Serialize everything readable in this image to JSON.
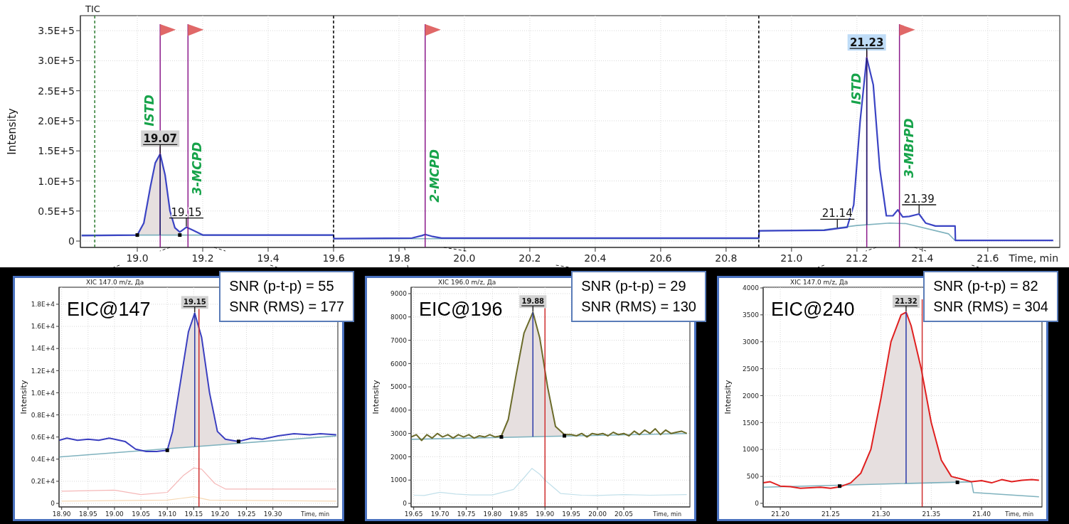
{
  "overview": {
    "title": "TIC",
    "chart_data": {
      "type": "line",
      "xlabel": "Time, min",
      "ylabel": "Intensity",
      "xlim": [
        18.826,
        21.82
      ],
      "ylim": [
        -10600,
        375000
      ],
      "grid": true,
      "xticks": [
        {
          "value": 19.0,
          "label": "19.0"
        },
        {
          "value": 19.2,
          "label": "19.2"
        },
        {
          "value": 19.4,
          "label": "19.4"
        },
        {
          "value": 19.6,
          "label": "19.6"
        },
        {
          "value": 19.8,
          "label": "19.8"
        },
        {
          "value": 20.0,
          "label": "20.0"
        },
        {
          "value": 20.2,
          "label": "20.2"
        },
        {
          "value": 20.4,
          "label": "20.4"
        },
        {
          "value": 20.6,
          "label": "20.6"
        },
        {
          "value": 20.8,
          "label": "20.8"
        },
        {
          "value": 21.0,
          "label": "21.0"
        },
        {
          "value": 21.2,
          "label": "21.2"
        },
        {
          "value": 21.4,
          "label": "21.4"
        },
        {
          "value": 21.6,
          "label": "21.6"
        }
      ],
      "yticks": [
        {
          "value": 0,
          "label": "0"
        },
        {
          "value": 50000,
          "label": "0.5E+5"
        },
        {
          "value": 100000,
          "label": "1.0E+5"
        },
        {
          "value": 150000,
          "label": "1.5E+5"
        },
        {
          "value": 200000,
          "label": "2.0E+5"
        },
        {
          "value": 250000,
          "label": "2.5E+5"
        },
        {
          "value": 300000,
          "label": "3.0E+5"
        },
        {
          "value": 350000,
          "label": "3.5E+5"
        }
      ],
      "series": [
        {
          "color": "#3b44c4",
          "x": [
            18.83,
            19.0,
            19.02,
            19.04,
            19.055,
            19.07,
            19.085,
            19.1,
            19.115,
            19.13,
            19.15,
            19.17,
            19.2,
            19.6,
            19.601,
            19.84,
            19.87,
            19.88,
            19.9,
            19.93,
            20.9,
            20.901,
            21.1,
            21.14,
            21.17,
            21.19,
            21.21,
            21.23,
            21.25,
            21.27,
            21.29,
            21.31,
            21.325,
            21.34,
            21.36,
            21.39,
            21.41,
            21.44,
            21.5,
            21.501,
            21.8
          ],
          "values": [
            9000,
            10000,
            30000,
            90000,
            130000,
            145000,
            110000,
            50000,
            22000,
            15000,
            23000,
            18000,
            10000,
            10000,
            4000,
            5000,
            9000,
            11000,
            8000,
            5000,
            5000,
            17000,
            18000,
            21000,
            23000,
            60000,
            200000,
            305000,
            260000,
            120000,
            42000,
            42000,
            52000,
            40000,
            41000,
            45000,
            30000,
            25000,
            25000,
            1000,
            1000
          ]
        },
        {
          "color": "#7fb2be",
          "x": [
            18.83,
            19.6,
            19.601,
            20.9,
            20.901,
            21.1,
            21.2,
            21.3,
            21.35,
            21.48,
            21.5
          ],
          "values": [
            10000,
            10000,
            4000,
            4000,
            17000,
            19000,
            26000,
            30000,
            29000,
            12000,
            1000
          ]
        },
        {
          "type": "scatter",
          "color": "#000000",
          "x": [
            19.0,
            19.13
          ],
          "values": [
            10000,
            10000
          ]
        }
      ],
      "ref_lines": [
        {
          "axis": "x",
          "value": 18.87,
          "color": "#2e7d32"
        },
        {
          "axis": "x",
          "value": 19.6,
          "color": "#000000"
        },
        {
          "axis": "x",
          "value": 20.9,
          "color": "#000000"
        },
        {
          "axis": "x",
          "value": 19.07,
          "color": "#8b1a8b",
          "label": "ISTD"
        },
        {
          "axis": "x",
          "value": 19.155,
          "color": "#8b1a8b",
          "label": "3-MCPD"
        },
        {
          "axis": "x",
          "value": 19.88,
          "color": "#8b1a8b",
          "label": "2-MCPD"
        },
        {
          "axis": "x",
          "value": 21.23,
          "color": "#8b1a8b",
          "label": "ISTD"
        },
        {
          "axis": "x",
          "value": 21.33,
          "color": "#8b1a8b",
          "label": "3-MBrPD"
        }
      ],
      "annotations": [
        {
          "x": 19.07,
          "y": 145000,
          "text": "19.07"
        },
        {
          "x": 19.15,
          "y": 23000,
          "text": "19.15"
        },
        {
          "x": 21.14,
          "y": 21000,
          "text": "21.14"
        },
        {
          "x": 21.23,
          "y": 305000,
          "text": "21.23"
        },
        {
          "x": 21.39,
          "y": 45000,
          "text": "21.39"
        }
      ]
    },
    "peak_labels": [
      {
        "boxed": true,
        "selected": false
      },
      {
        "boxed": false,
        "selected": false
      },
      {
        "boxed": false,
        "selected": false
      },
      {
        "boxed": true,
        "selected": true
      },
      {
        "boxed": false,
        "selected": false
      }
    ]
  },
  "panels": [
    {
      "title": "XIC 147.0 m/z, Да",
      "label": "EIC@147",
      "snr": [
        "SNR (p-t-p) = 55",
        "SNR (RMS) = 177"
      ],
      "chart_data": {
        "type": "line",
        "xlabel": "Time, min",
        "ylabel": "Intensity",
        "xlim": [
          18.895,
          19.423
        ],
        "ylim": [
          -320,
          19537
        ],
        "grid": true,
        "xticks": [
          {
            "value": 18.9,
            "label": "18.90"
          },
          {
            "value": 18.95,
            "label": "18.95"
          },
          {
            "value": 19.0,
            "label": "19.00"
          },
          {
            "value": 19.05,
            "label": "19.05"
          },
          {
            "value": 19.1,
            "label": "19.10"
          },
          {
            "value": 19.15,
            "label": "19.15"
          },
          {
            "value": 19.2,
            "label": "19.20"
          },
          {
            "value": 19.25,
            "label": "19.25"
          },
          {
            "value": 19.3,
            "label": "19.30"
          }
        ],
        "yticks": [
          {
            "value": 0,
            "label": "0"
          },
          {
            "value": 2000,
            "label": "0.2E+4"
          },
          {
            "value": 4000,
            "label": "0.4E+4"
          },
          {
            "value": 6000,
            "label": "0.6E+4"
          },
          {
            "value": 8000,
            "label": "0.8E+4"
          },
          {
            "value": 10000,
            "label": "1.0E+4"
          },
          {
            "value": 12000,
            "label": "1.2E+4"
          },
          {
            "value": 14000,
            "label": "1.4E+4"
          },
          {
            "value": 16000,
            "label": "1.6E+4"
          },
          {
            "value": 18000,
            "label": "1.8E+4"
          }
        ],
        "series": [
          {
            "color": "#3b3fc0",
            "x": [
              18.895,
              18.91,
              18.93,
              18.95,
              18.97,
              18.99,
              19.0,
              19.02,
              19.04,
              19.06,
              19.08,
              19.1,
              19.11,
              19.125,
              19.14,
              19.152,
              19.165,
              19.18,
              19.195,
              19.21,
              19.235,
              19.26,
              19.28,
              19.31,
              19.34,
              19.37,
              19.39,
              19.42
            ],
            "values": [
              5700,
              5900,
              5700,
              5800,
              5700,
              5900,
              5800,
              5600,
              4900,
              4700,
              4700,
              4800,
              6500,
              11000,
              15500,
              17200,
              15000,
              10000,
              6500,
              5800,
              5600,
              5900,
              5800,
              6100,
              6300,
              6200,
              6300,
              6200
            ]
          },
          {
            "color": "#7fb2be",
            "x": [
              18.895,
              19.42
            ],
            "values": [
              4200,
              6100
            ]
          },
          {
            "type": "scatter",
            "color": "#000000",
            "x": [
              19.1,
              19.235
            ],
            "values": [
              4800,
              5600
            ]
          },
          {
            "color": "#f5b8b8",
            "x": [
              18.9,
              19.0,
              19.05,
              19.1,
              19.13,
              19.15,
              19.165,
              19.19,
              19.21,
              19.3,
              19.42
            ],
            "values": [
              1100,
              1200,
              800,
              1000,
              2500,
              3200,
              3100,
              1800,
              1300,
              1300,
              1300
            ]
          },
          {
            "color": "#f6d8b4",
            "x": [
              18.9,
              19.1,
              19.15,
              19.18,
              19.42
            ],
            "values": [
              200,
              300,
              600,
              300,
              200
            ]
          }
        ],
        "ref_lines": [
          {
            "axis": "x",
            "value": 19.16,
            "color": "#d03030"
          }
        ],
        "annotations": [
          {
            "x": 19.152,
            "y": 17200,
            "text": "19.15"
          }
        ]
      },
      "peak_labels": [
        {
          "boxed": true,
          "selected": false
        }
      ]
    },
    {
      "title": "XIC 196.0 m/z, Да",
      "label": "EIC@196",
      "snr": [
        "SNR (p-t-p) = 29",
        "SNR (RMS) = 130"
      ],
      "chart_data": {
        "type": "line",
        "xlabel": "Time, min",
        "ylabel": "Intensity",
        "xlim": [
          19.645,
          20.176
        ],
        "ylim": [
          -152,
          9274
        ],
        "grid": true,
        "xticks": [
          {
            "value": 19.65,
            "label": "19.65"
          },
          {
            "value": 19.7,
            "label": "19.70"
          },
          {
            "value": 19.75,
            "label": "19.75"
          },
          {
            "value": 19.8,
            "label": "19.80"
          },
          {
            "value": 19.85,
            "label": "19.85"
          },
          {
            "value": 19.9,
            "label": "19.90"
          },
          {
            "value": 19.95,
            "label": "19.95"
          },
          {
            "value": 20.0,
            "label": "20.00"
          },
          {
            "value": 20.05,
            "label": "20.05"
          }
        ],
        "yticks": [
          {
            "value": 0,
            "label": "0"
          },
          {
            "value": 1000,
            "label": "1000"
          },
          {
            "value": 2000,
            "label": "2000"
          },
          {
            "value": 3000,
            "label": "3000"
          },
          {
            "value": 4000,
            "label": "4000"
          },
          {
            "value": 5000,
            "label": "5000"
          },
          {
            "value": 6000,
            "label": "6000"
          },
          {
            "value": 7000,
            "label": "7000"
          },
          {
            "value": 8000,
            "label": "8000"
          },
          {
            "value": 9000,
            "label": "9000"
          }
        ],
        "series": [
          {
            "color": "#6b6b2a",
            "x": [
              19.645,
              19.655,
              19.665,
              19.675,
              19.685,
              19.695,
              19.705,
              19.715,
              19.725,
              19.735,
              19.745,
              19.755,
              19.765,
              19.775,
              19.785,
              19.795,
              19.805,
              19.817,
              19.83,
              19.845,
              19.86,
              19.877,
              19.89,
              19.905,
              19.92,
              19.937,
              19.95,
              19.96,
              19.97,
              19.98,
              19.99,
              20.0,
              20.01,
              20.02,
              20.03,
              20.04,
              20.05,
              20.06,
              20.07,
              20.08,
              20.09,
              20.1,
              20.11,
              20.12,
              20.13,
              20.14,
              20.15,
              20.16,
              20.17
            ],
            "values": [
              2850,
              2950,
              2700,
              2950,
              2800,
              3000,
              2850,
              2950,
              2800,
              2950,
              2850,
              2950,
              2800,
              2900,
              2850,
              2950,
              2850,
              2900,
              3600,
              5500,
              7300,
              8200,
              7100,
              5000,
              3300,
              2950,
              2950,
              2900,
              3000,
              2850,
              3000,
              2950,
              3000,
              2900,
              3050,
              2950,
              3000,
              2900,
              3100,
              2950,
              3150,
              3000,
              3200,
              2950,
              3150,
              3000,
              3050,
              3100,
              3000
            ]
          },
          {
            "color": "#7fb2be",
            "x": [
              19.645,
              20.17
            ],
            "values": [
              2750,
              3000
            ]
          },
          {
            "type": "scatter",
            "color": "#000000",
            "x": [
              19.817,
              19.937
            ],
            "values": [
              2850,
              2900
            ]
          },
          {
            "color": "#c2e0ea",
            "x": [
              19.65,
              19.67,
              19.7,
              19.73,
              19.76,
              19.8,
              19.84,
              19.86,
              19.875,
              19.89,
              19.9,
              19.93,
              19.97,
              20.0,
              20.05,
              20.1,
              20.17
            ],
            "values": [
              350,
              340,
              480,
              400,
              360,
              360,
              600,
              1100,
              1500,
              1250,
              1000,
              420,
              350,
              340,
              380,
              350,
              380
            ]
          }
        ],
        "ref_lines": [
          {
            "axis": "x",
            "value": 19.9,
            "color": "#d03030"
          }
        ],
        "annotations": [
          {
            "x": 19.877,
            "y": 8200,
            "text": "19.88"
          }
        ]
      },
      "peak_labels": [
        {
          "boxed": true,
          "selected": false
        }
      ]
    },
    {
      "title": "XIC 147.0 m/z, Да",
      "label": "EIC@240",
      "snr": [
        "SNR (p-t-p) = 82",
        "SNR (RMS) = 304"
      ],
      "chart_data": {
        "type": "line",
        "xlabel": "Time, min",
        "ylabel": "Intensity",
        "xlim": [
          21.183,
          21.46
        ],
        "ylim": [
          -67,
          4013
        ],
        "grid": true,
        "xticks": [
          {
            "value": 21.2,
            "label": "21.20"
          },
          {
            "value": 21.25,
            "label": "21.25"
          },
          {
            "value": 21.3,
            "label": "21.30"
          },
          {
            "value": 21.35,
            "label": "21.35"
          },
          {
            "value": 21.4,
            "label": "21.40"
          }
        ],
        "yticks": [
          {
            "value": 0,
            "label": "0"
          },
          {
            "value": 500,
            "label": "500"
          },
          {
            "value": 1000,
            "label": "1000"
          },
          {
            "value": 1500,
            "label": "1500"
          },
          {
            "value": 2000,
            "label": "2000"
          },
          {
            "value": 2500,
            "label": "2500"
          },
          {
            "value": 3000,
            "label": "3000"
          },
          {
            "value": 3500,
            "label": "3500"
          },
          {
            "value": 4000,
            "label": "4000"
          }
        ],
        "series": [
          {
            "color": "#e02020",
            "x": [
              21.183,
              21.19,
              21.2,
              21.21,
              21.22,
              21.23,
              21.24,
              21.25,
              21.26,
              21.27,
              21.28,
              21.29,
              21.3,
              21.31,
              21.32,
              21.325,
              21.33,
              21.34,
              21.35,
              21.36,
              21.37,
              21.38,
              21.39,
              21.4,
              21.41,
              21.42,
              21.43,
              21.44,
              21.45,
              21.457
            ],
            "values": [
              380,
              400,
              320,
              310,
              280,
              290,
              300,
              280,
              310,
              380,
              560,
              1000,
              1950,
              3000,
              3500,
              3550,
              3300,
              2500,
              1500,
              800,
              500,
              450,
              400,
              420,
              380,
              440,
              400,
              430,
              440,
              430
            ]
          },
          {
            "color": "#7fb2be",
            "x": [
              21.183,
              21.39,
              21.392,
              21.457
            ],
            "values": [
              300,
              400,
              200,
              120
            ]
          },
          {
            "type": "scatter",
            "color": "#000000",
            "x": [
              21.259,
              21.376
            ],
            "values": [
              320,
              390
            ]
          }
        ],
        "ref_lines": [
          {
            "axis": "x",
            "value": 21.341,
            "color": "#d03030"
          }
        ],
        "annotations": [
          {
            "x": 21.325,
            "y": 3550,
            "text": "21.32"
          }
        ]
      },
      "peak_labels": [
        {
          "boxed": true,
          "selected": false
        }
      ]
    }
  ]
}
